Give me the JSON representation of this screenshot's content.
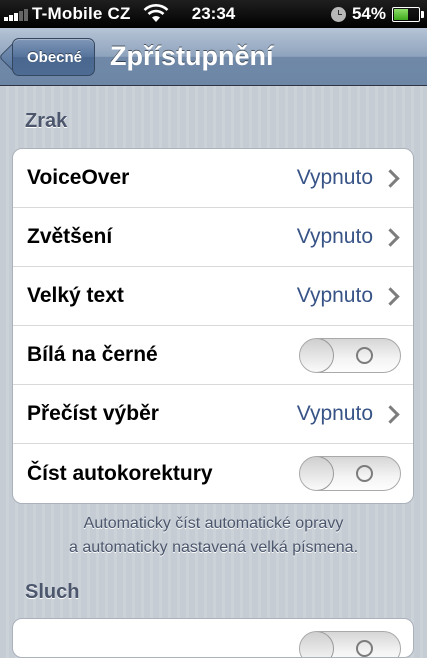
{
  "status_bar": {
    "carrier": "T-Mobile CZ",
    "time": "23:34",
    "battery_percent": "54%",
    "battery_level": 0.54,
    "signal_bars_on": 3,
    "signal_bars_total": 5,
    "icons": [
      "signal-icon",
      "wifi-icon",
      "clock-icon",
      "battery-icon"
    ]
  },
  "nav": {
    "back_label": "Obecné",
    "title": "Zpřístupnění"
  },
  "sections": {
    "vision": {
      "header": "Zrak",
      "rows": [
        {
          "label": "VoiceOver",
          "value": "Vypnuto",
          "type": "disclosure"
        },
        {
          "label": "Zvětšení",
          "value": "Vypnuto",
          "type": "disclosure"
        },
        {
          "label": "Velký text",
          "value": "Vypnuto",
          "type": "disclosure"
        },
        {
          "label": "Bílá na černé",
          "type": "toggle",
          "on": false
        },
        {
          "label": "Přečíst výběr",
          "value": "Vypnuto",
          "type": "disclosure"
        },
        {
          "label": "Číst autokorektury",
          "type": "toggle",
          "on": false
        }
      ],
      "footer_line1": "Automaticky číst automatické opravy",
      "footer_line2": "a automaticky nastavená velká písmena."
    },
    "hearing": {
      "header": "Sluch"
    }
  },
  "colors": {
    "accent_value": "#385487",
    "nav_bar": "#6d86a6",
    "section_header": "#4c566c"
  }
}
